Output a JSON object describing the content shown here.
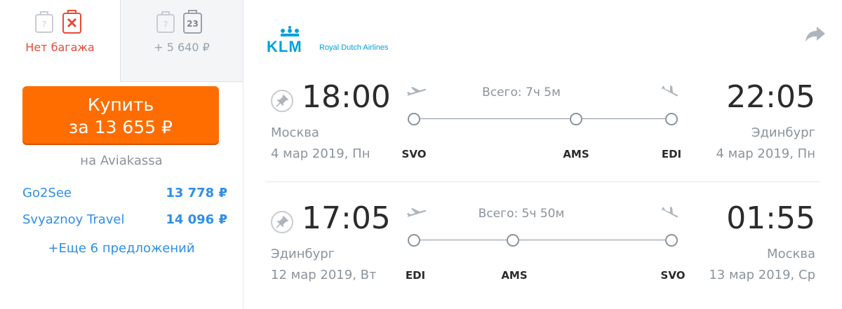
{
  "baggage": {
    "option1": {
      "label": "Нет багажа"
    },
    "option2": {
      "label": "+ 5 640 ₽",
      "weight_badge": "23"
    },
    "unknown_mark": "?"
  },
  "purchase": {
    "button_line1": "Купить",
    "button_line2": "за 13 655 ₽",
    "vendor": "на Aviakassa"
  },
  "agents": [
    {
      "name": "Go2See",
      "price": "13 778 ₽"
    },
    {
      "name": "Svyaznoy Travel",
      "price": "14 096 ₽"
    }
  ],
  "more_offers": "+Еще 6 предложений",
  "airline": {
    "logo_text": "KLM",
    "logo_subtitle": "Royal Dutch Airlines"
  },
  "legs": [
    {
      "dep_time": "18:00",
      "dep_city": "Москва",
      "dep_date": "4 мар 2019, Пн",
      "total": "Всего: 7ч 5м",
      "stops": [
        "SVO",
        "AMS",
        "EDI"
      ],
      "arr_time": "22:05",
      "arr_city": "Эдинбург",
      "arr_date": "4 мар 2019, Пн"
    },
    {
      "dep_time": "17:05",
      "dep_city": "Эдинбург",
      "dep_date": "12 мар 2019, Вт",
      "total": "Всего: 5ч 50м",
      "stops": [
        "EDI",
        "AMS",
        "SVO"
      ],
      "arr_time": "01:55",
      "arr_city": "Москва",
      "arr_date": "13 мар 2019, Ср"
    }
  ],
  "colors": {
    "accent_orange": "#ff6d00",
    "link_blue": "#2f8fe8",
    "no_baggage_red": "#e84a3a",
    "klm_blue": "#00a1de"
  }
}
